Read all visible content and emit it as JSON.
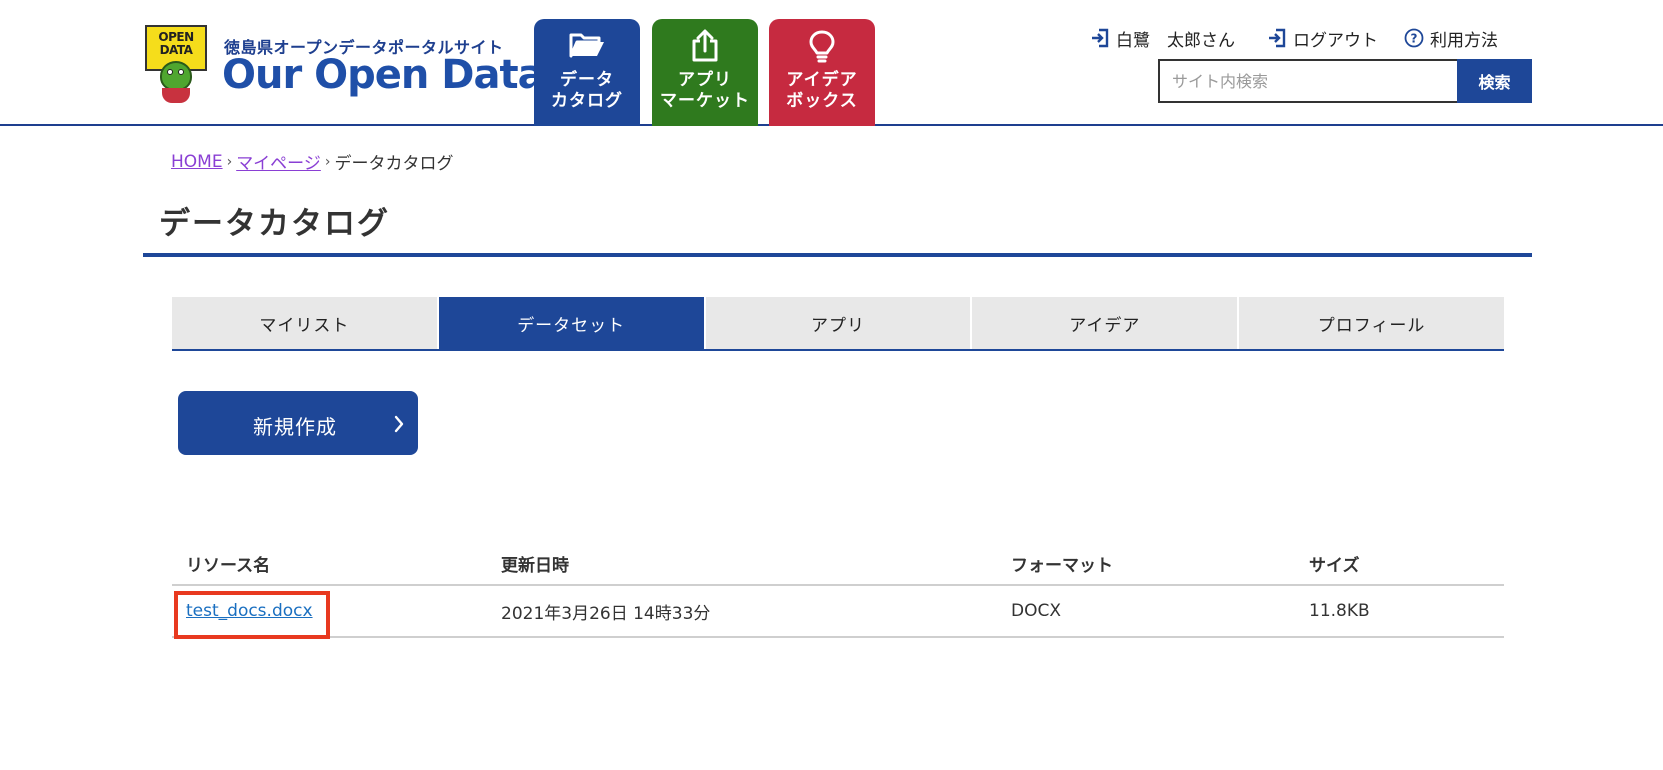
{
  "header": {
    "logo": {
      "badge_line1": "OPEN",
      "badge_line2": "DATA",
      "subtitle": "徳島県オープンデータポータルサイト",
      "title": "Our Open Data"
    },
    "nav": [
      {
        "line1": "データ",
        "line2": "カタログ",
        "icon": "folder-open-icon",
        "color": "#1e4798"
      },
      {
        "line1": "アプリ",
        "line2": "マーケット",
        "icon": "share-upload-icon",
        "color": "#2f7a1e"
      },
      {
        "line1": "アイデア",
        "line2": "ボックス",
        "icon": "lightbulb-icon",
        "color": "#c62a40"
      }
    ],
    "user_label": "白鷺　太郎さん",
    "logout_label": "ログアウト",
    "help_label": "利用方法",
    "search": {
      "placeholder": "サイト内検索",
      "button_label": "検索"
    }
  },
  "breadcrumb": {
    "home": "HOME",
    "mypage": "マイページ",
    "current": "データカタログ",
    "separator": "›"
  },
  "page_title": "データカタログ",
  "tabs": [
    {
      "label": "マイリスト",
      "active": false
    },
    {
      "label": "データセット",
      "active": true
    },
    {
      "label": "アプリ",
      "active": false
    },
    {
      "label": "アイデア",
      "active": false
    },
    {
      "label": "プロフィール",
      "active": false
    }
  ],
  "new_button_label": "新規作成",
  "table": {
    "headers": [
      "リソース名",
      "更新日時",
      "フォーマット",
      "サイズ"
    ],
    "rows": [
      {
        "name": "test_docs.docx",
        "updated": "2021年3月26日 14時33分",
        "format": "DOCX",
        "size": "11.8KB"
      }
    ]
  },
  "colors": {
    "primary": "#1e4798",
    "app_green": "#2f7a1e",
    "idea_red": "#c62a40",
    "link_purple": "#8a3fd4",
    "link_blue": "#1a6fc0",
    "highlight_red": "#e8391f"
  }
}
